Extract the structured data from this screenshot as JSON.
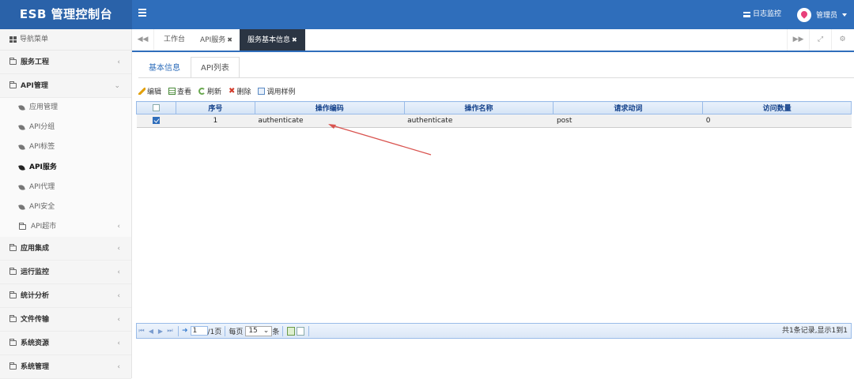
{
  "header": {
    "title": "ESB 管理控制台",
    "log_monitor": "日志监控",
    "user": "管理员"
  },
  "sidebar": {
    "nav_title": "导航菜单",
    "items": [
      {
        "label": "服务工程"
      },
      {
        "label": "API管理",
        "expanded": true,
        "children": [
          "应用管理",
          "API分组",
          "API标签",
          "API服务",
          "API代理",
          "API安全",
          "API超市"
        ],
        "active_child": "API服务"
      },
      {
        "label": "应用集成"
      },
      {
        "label": "运行监控"
      },
      {
        "label": "统计分析"
      },
      {
        "label": "文件传输"
      },
      {
        "label": "系统资源"
      },
      {
        "label": "系统管理"
      }
    ]
  },
  "tabs": [
    {
      "label": "工作台"
    },
    {
      "label": "API服务"
    },
    {
      "label": "服务基本信息",
      "active": true
    }
  ],
  "subtabs": [
    "基本信息",
    "API列表"
  ],
  "toolbar": {
    "edit": "编辑",
    "view": "查看",
    "refresh": "刷新",
    "delete": "删除",
    "sample": "调用样例"
  },
  "grid": {
    "columns": [
      "序号",
      "操作编码",
      "操作名称",
      "请求动词",
      "访问数量"
    ],
    "rows": [
      {
        "index": "1",
        "code": "authenticate",
        "name": "authenticate",
        "verb": "post",
        "visits": "0",
        "checked": true
      }
    ]
  },
  "pager": {
    "page": "1",
    "total_pages": "/1页",
    "per_page_label": "每页",
    "per_page_value": "15",
    "per_page_unit": "条",
    "info": "共1条记录,显示1到1"
  },
  "colors": {
    "header": "#2f6ebb",
    "active_tab": "#2b3543",
    "annotation_arrow": "#d9534f"
  }
}
